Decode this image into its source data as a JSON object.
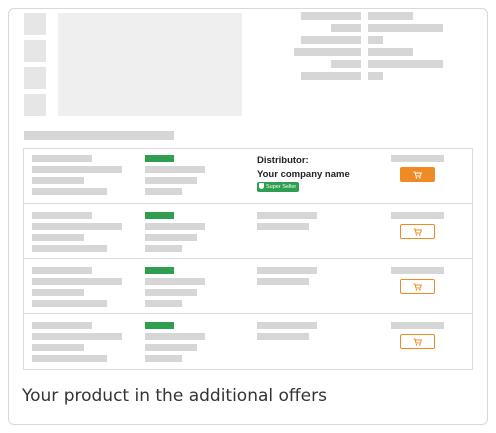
{
  "offers": {
    "distributor_label": "Distributor:",
    "company_name": "Your company name",
    "badge_label": "Super Seller",
    "icons": {
      "badge": "shield-icon",
      "button": "cart-icon"
    },
    "colors": {
      "accent": "#f08a24",
      "badge": "#2e9e4f"
    }
  },
  "caption": "Your product in the additional offers"
}
